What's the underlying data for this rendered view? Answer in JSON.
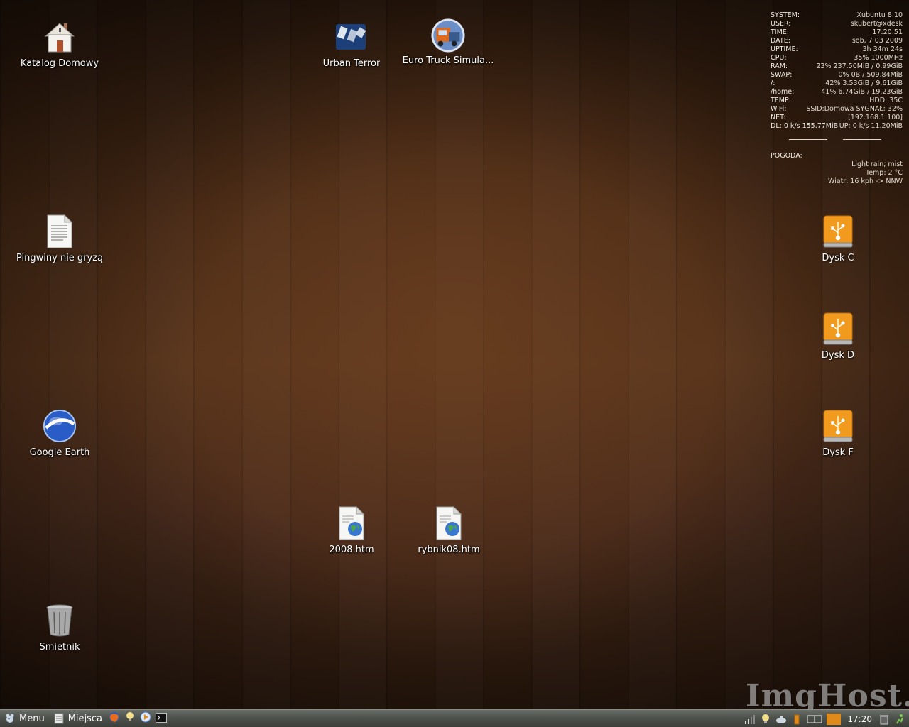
{
  "desktop": {
    "icons": {
      "home": {
        "label": "Katalog Domowy",
        "icon": "home-folder-icon"
      },
      "urban_terror": {
        "label": "Urban Terror",
        "icon": "urban-terror-icon"
      },
      "euro_truck": {
        "label": "Euro Truck Simula...",
        "icon": "euro-truck-icon"
      },
      "pingwiny": {
        "label": "Pingwiny nie gryzą",
        "icon": "text-document-icon"
      },
      "google_earth": {
        "label": "Google Earth",
        "icon": "google-earth-icon"
      },
      "htm_2008": {
        "label": "2008.htm",
        "icon": "html-document-icon"
      },
      "rybnik": {
        "label": "rybnik08.htm",
        "icon": "html-document-icon"
      },
      "trash": {
        "label": "Śmietnik",
        "icon": "trash-icon"
      },
      "dysk_c": {
        "label": "Dysk C",
        "icon": "usb-drive-icon"
      },
      "dysk_d": {
        "label": "Dysk D",
        "icon": "usb-drive-icon"
      },
      "dysk_f": {
        "label": "Dysk F",
        "icon": "usb-drive-icon"
      }
    }
  },
  "conky": {
    "rows": [
      {
        "k": "SYSTEM:",
        "v": "Xubuntu 8.10"
      },
      {
        "k": "USER:",
        "v": "skubert@xdesk"
      },
      {
        "k": "TIME:",
        "v": "17:20:51"
      },
      {
        "k": "DATE:",
        "v": "sob,  7 03 2009"
      },
      {
        "k": "UPTIME:",
        "v": "3h 34m 24s"
      },
      {
        "k": "CPU:",
        "v": "35% 1000MHz"
      },
      {
        "k": "RAM:",
        "v": "23% 237.50MiB / 0.99GiB"
      },
      {
        "k": "SWAP:",
        "v": "0% 0B / 509.84MiB"
      },
      {
        "k": "/:",
        "v": "42% 3.53GiB / 9.61GiB"
      },
      {
        "k": "/home:",
        "v": "41% 6.74GiB / 19.23GiB"
      },
      {
        "k": "TEMP:",
        "v": "HDD: 35C"
      },
      {
        "k": "WiFi:",
        "v": "SSID:Domowa SYGNAŁ: 32%"
      },
      {
        "k": "NET:",
        "v": "[192.168.1.100]"
      },
      {
        "k": "DL: 0 k/s 155.77MiB",
        "v": "UP: 0 k/s 11.20MiB"
      }
    ],
    "weather_label": "POGODA:",
    "weather_lines": [
      "Light rain; mist",
      "Temp: 2 °C",
      "Wiatr: 16 kph -> NNW"
    ]
  },
  "taskbar": {
    "menu_label": "Menu",
    "places_label": "Miejsca",
    "clock": "17:20"
  },
  "watermark": "ImgHost.pl",
  "colors": {
    "drive_orange": "#f29a1e",
    "taskbar": "#4e524c"
  }
}
